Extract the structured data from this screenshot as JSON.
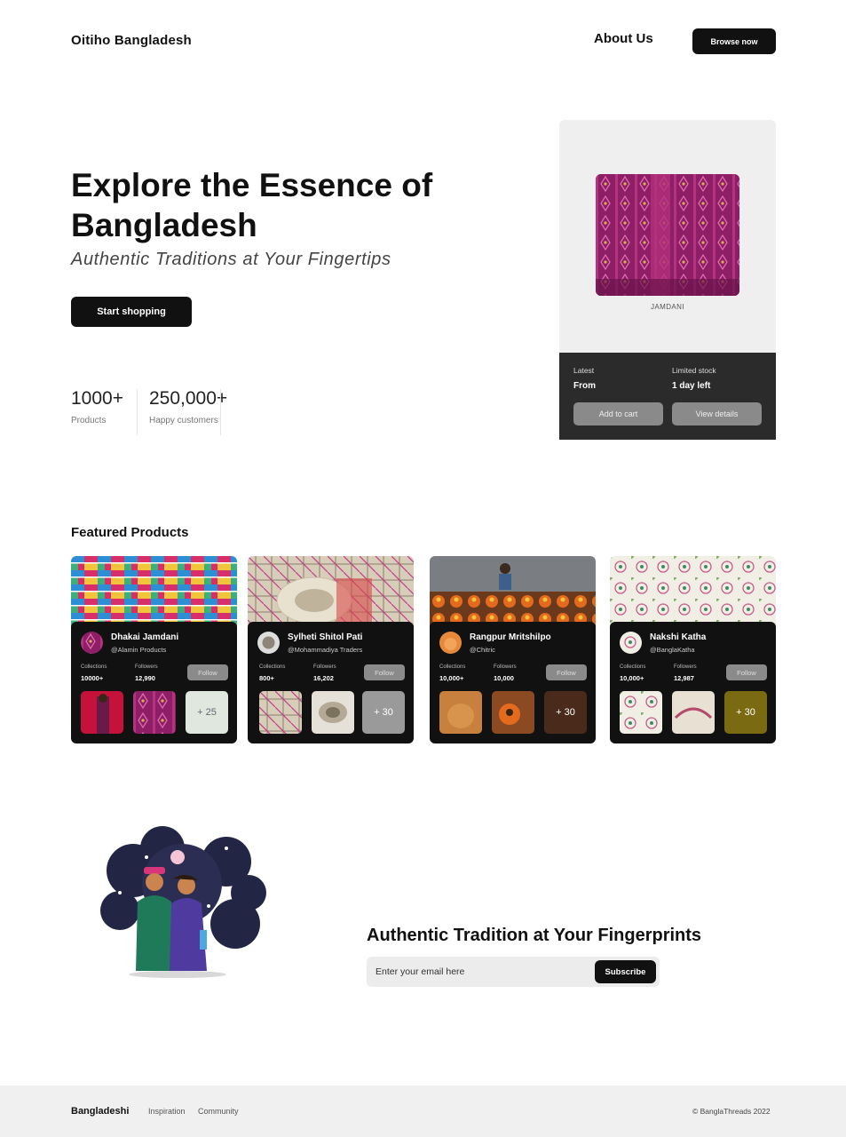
{
  "nav": {
    "brand": "Oitiho Bangladesh",
    "about_label": "About Us",
    "browse_label": "Browse now"
  },
  "hero": {
    "title": "Explore the Essence of Bangladesh",
    "subtitle": "Authentic Traditions at Your Fingertips",
    "cta_label": "Start shopping",
    "stats": [
      {
        "value": "1000+",
        "label": "Products"
      },
      {
        "value": "250,000+",
        "label": "Happy customers"
      }
    ]
  },
  "highlight": {
    "product_name": "JAMDANI",
    "left_label": "Latest",
    "left_value": "From",
    "right_label": "Limited stock",
    "right_value": "1 day left",
    "add_label": "Add to cart",
    "view_label": "View details"
  },
  "featured": {
    "title": "Featured Products",
    "collections_label": "Collections",
    "followers_label": "Followers",
    "follow_label": "Follow",
    "cards": [
      {
        "name": "Dhakai Jamdani",
        "handle": "@Alamin Products",
        "collections": "10000+",
        "followers": "12,990",
        "more": "+ 25"
      },
      {
        "name": "Sylheti Shitol Pati",
        "handle": "@Mohammadiya Traders",
        "collections": "800+",
        "followers": "16,202",
        "more": "+ 30"
      },
      {
        "name": "Rangpur Mritshilpo",
        "handle": "@Chitric",
        "collections": "10,000+",
        "followers": "10,000",
        "more": "+ 30"
      },
      {
        "name": "Nakshi Katha",
        "handle": "@BanglaKatha",
        "collections": "10,000+",
        "followers": "12,987",
        "more": "+ 30"
      }
    ]
  },
  "cta": {
    "title": "Authentic Tradition at Your Fingerprints",
    "email_placeholder": "Enter your email here",
    "subscribe_label": "Subscribe"
  },
  "footer": {
    "brand": "Bangladeshi",
    "links": [
      "Inspiration",
      "Community"
    ],
    "copyright": "© BanglaThreads 2022"
  },
  "colors": {
    "dark": "#111111",
    "panel": "#2b2b2b",
    "muted_button": "#8a8a8a",
    "footer_bg": "#f0f0f0"
  }
}
